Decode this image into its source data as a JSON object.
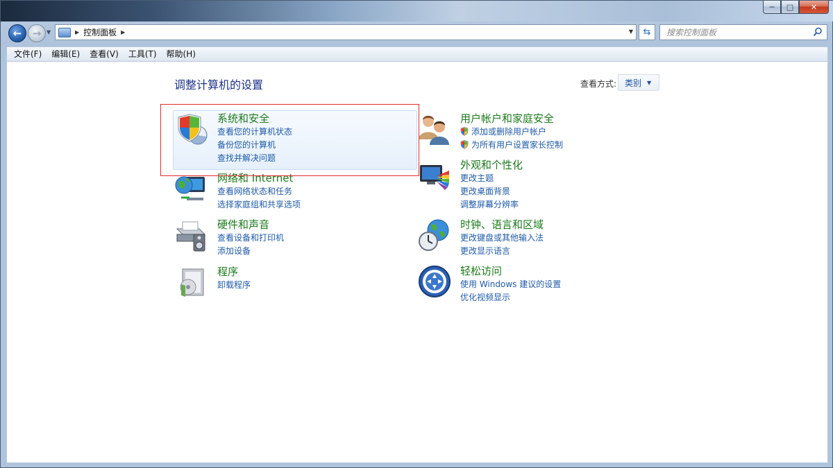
{
  "window": {
    "minimize_glyph": "─",
    "maximize_glyph": "□",
    "close_glyph": "✕"
  },
  "address": {
    "breadcrumb": "控制面板",
    "crumb_arrow": "▶",
    "dropdown_glyph": "▼",
    "refresh_glyph": "⇆"
  },
  "search": {
    "placeholder": "搜索控制面板",
    "icon": "search-icon"
  },
  "nav": {
    "back_glyph": "←",
    "forward_glyph": "→",
    "recent_glyph": "▼"
  },
  "menu": [
    {
      "label": "文件(F)"
    },
    {
      "label": "编辑(E)"
    },
    {
      "label": "查看(V)"
    },
    {
      "label": "工具(T)"
    },
    {
      "label": "帮助(H)"
    }
  ],
  "main": {
    "title": "调整计算机的设置",
    "view_by_label": "查看方式:",
    "view_by_value": "类别",
    "view_by_caret": "▼"
  },
  "categories": [
    {
      "title": "系统和安全",
      "icon": "system-security-icon",
      "links": [
        "查看您的计算机状态",
        "备份您的计算机",
        "查找并解决问题"
      ]
    },
    {
      "title": "网络和 Internet",
      "icon": "network-internet-icon",
      "links": [
        "查看网络状态和任务",
        "选择家庭组和共享选项"
      ]
    },
    {
      "title": "硬件和声音",
      "icon": "hardware-sound-icon",
      "links": [
        "查看设备和打印机",
        "添加设备"
      ]
    },
    {
      "title": "程序",
      "icon": "programs-icon",
      "links": [
        "卸载程序"
      ]
    },
    {
      "title": "用户帐户和家庭安全",
      "icon": "user-accounts-icon",
      "links": [
        "添加或删除用户帐户",
        "为所有用户设置家长控制"
      ]
    },
    {
      "title": "外观和个性化",
      "icon": "appearance-icon",
      "links": [
        "更改主题",
        "更改桌面背景",
        "调整屏幕分辨率"
      ]
    },
    {
      "title": "时钟、语言和区域",
      "icon": "clock-language-icon",
      "links": [
        "更改键盘或其他输入法",
        "更改显示语言"
      ]
    },
    {
      "title": "轻松访问",
      "icon": "ease-of-access-icon",
      "links": [
        "使用 Windows 建议的设置",
        "优化视频显示"
      ]
    }
  ],
  "colors": {
    "category_title": "#1b7a1b",
    "link": "#1e5aa8",
    "page_title": "#1e3287",
    "highlight_border": "#e02b2b"
  }
}
